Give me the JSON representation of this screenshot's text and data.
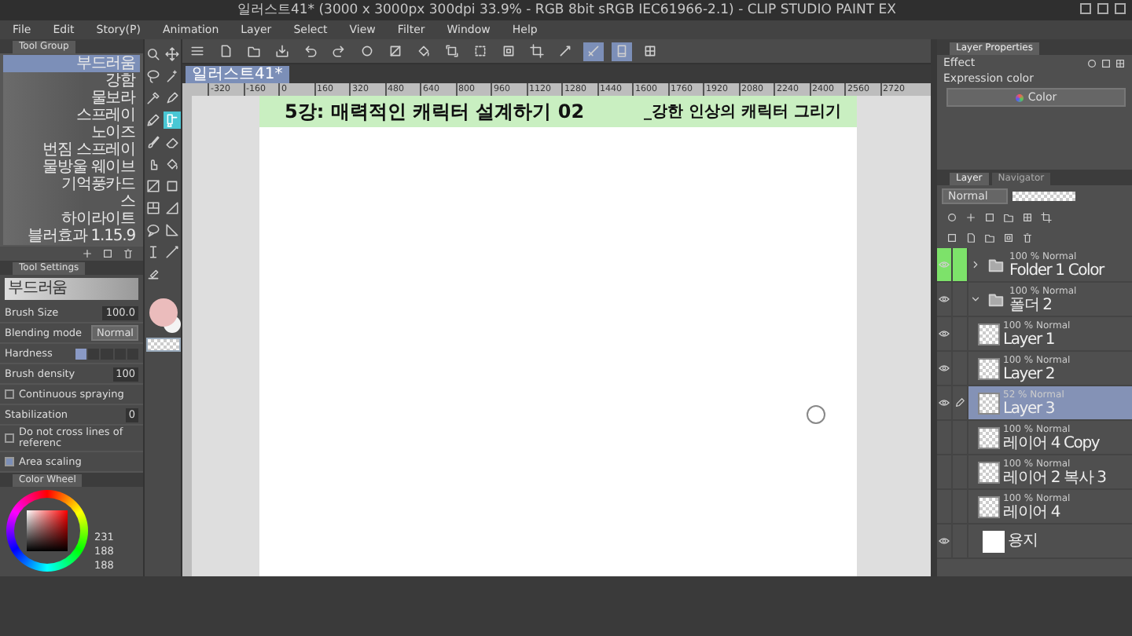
{
  "window": {
    "title": "일러스트41* (3000 x 3000px 300dpi 33.9% - RGB 8bit sRGB IEC61966-2.1) - CLIP STUDIO PAINT EX"
  },
  "menu": [
    "File",
    "Edit",
    "Story(P)",
    "Animation",
    "Layer",
    "Select",
    "View",
    "Filter",
    "Window",
    "Help"
  ],
  "toolbar": [
    {
      "kind": "menu",
      "selected": false
    },
    {
      "kind": "new",
      "selected": false
    },
    {
      "kind": "open",
      "selected": false
    },
    {
      "kind": "save",
      "selected": false
    },
    {
      "kind": "undo",
      "selected": false
    },
    {
      "kind": "redo",
      "selected": false
    },
    {
      "kind": "spinner",
      "selected": false
    },
    {
      "kind": "clear",
      "selected": false
    },
    {
      "kind": "fill",
      "selected": false
    },
    {
      "kind": "transform",
      "selected": false
    },
    {
      "kind": "deselect",
      "selected": false
    },
    {
      "kind": "invert",
      "selected": false
    },
    {
      "kind": "crop",
      "selected": false
    },
    {
      "kind": "snap_ruler",
      "selected": false
    },
    {
      "kind": "snap_special",
      "selected": true
    },
    {
      "kind": "snap_grid",
      "selected": true
    },
    {
      "kind": "grid",
      "selected": false
    }
  ],
  "tool_group": {
    "tab": "Tool Group",
    "items": [
      {
        "label": "부드러움",
        "selected": true
      },
      {
        "label": "강함",
        "selected": false
      },
      {
        "label": "물보라",
        "selected": false
      },
      {
        "label": "스프레이",
        "selected": false
      },
      {
        "label": "노이즈",
        "selected": false
      },
      {
        "label": "번짐 스프레이",
        "selected": false
      },
      {
        "label": "물방울 웨이브",
        "selected": false
      },
      {
        "label": "기억풍카드",
        "selected": false
      },
      {
        "label": "스",
        "selected": false
      },
      {
        "label": "하이라이트",
        "selected": false
      },
      {
        "label": "블러효과 1.15.9",
        "selected": false
      }
    ]
  },
  "tool_settings": {
    "tab": "Tool Settings",
    "preset": "부드러움",
    "brush_size": {
      "label": "Brush Size",
      "value": "100.0"
    },
    "blending_mode": {
      "label": "Blending mode",
      "value": "Normal"
    },
    "hardness": {
      "label": "Hardness",
      "level": 0.2
    },
    "brush_density": {
      "label": "Brush density",
      "value": "100"
    },
    "continuous_spraying": {
      "label": "Continuous spraying",
      "checked": false
    },
    "stabilization": {
      "label": "Stabilization",
      "value": "0"
    },
    "do_not_cross": {
      "label": "Do not cross lines of referenc",
      "checked": false
    },
    "area_scaling": {
      "label": "Area scaling",
      "checked": true
    }
  },
  "color_wheel": {
    "tab": "Color Wheel",
    "r": "231",
    "g": "188",
    "b": "188"
  },
  "tools": [
    {
      "kind": "zoom",
      "selected": false
    },
    {
      "kind": "move",
      "selected": false
    },
    {
      "kind": "lasso",
      "selected": false
    },
    {
      "kind": "wand",
      "selected": false
    },
    {
      "kind": "eyedropper",
      "selected": false
    },
    {
      "kind": "pen",
      "selected": false
    },
    {
      "kind": "pencil",
      "selected": false
    },
    {
      "kind": "airbrush",
      "selected": true
    },
    {
      "kind": "brush",
      "selected": false
    },
    {
      "kind": "eraser",
      "selected": false
    },
    {
      "kind": "blend",
      "selected": false
    },
    {
      "kind": "fill",
      "selected": false
    },
    {
      "kind": "gradient",
      "selected": false
    },
    {
      "kind": "figure",
      "selected": false
    },
    {
      "kind": "frame",
      "selected": false
    },
    {
      "kind": "ruler",
      "selected": false
    },
    {
      "kind": "balloon",
      "selected": false
    },
    {
      "kind": "ruler2",
      "selected": false
    },
    {
      "kind": "text",
      "selected": false
    },
    {
      "kind": "line",
      "selected": false
    },
    {
      "kind": "correct",
      "selected": false
    }
  ],
  "document_tab": "일러스트41*",
  "ruler": [
    "-320",
    "-160",
    "0",
    "160",
    "320",
    "480",
    "640",
    "800",
    "960",
    "1120",
    "1280",
    "1440",
    "1600",
    "1760",
    "1920",
    "2080",
    "2240",
    "2400",
    "2560",
    "2720"
  ],
  "canvas": {
    "title": "5강: 매력적인 캐릭터 설계하기 02",
    "subtitle": "_강한 인상의 캐릭터 그리기"
  },
  "layer_properties": {
    "tab": "Layer Properties",
    "effect_label": "Effect",
    "expression_label": "Expression color",
    "expression_value": "Color"
  },
  "layer_panel": {
    "tabs": [
      {
        "label": "Layer",
        "selected": true
      },
      {
        "label": "Navigator",
        "selected": false
      }
    ],
    "blend_mode": "Normal",
    "opacity": {
      "level": 1
    },
    "layers": [
      {
        "kind": "folder",
        "mode": "100 % Normal",
        "name": "Folder 1 Color",
        "visible": true,
        "highlighted": true,
        "editing": false,
        "selected": false,
        "expanded": false
      },
      {
        "kind": "folder",
        "mode": "100 % Normal",
        "name": "폴더 2",
        "visible": true,
        "highlighted": false,
        "editing": false,
        "selected": false,
        "expanded": true,
        "children": [
          {
            "kind": "layer",
            "mode": "100 % Normal",
            "name": "Layer 1",
            "visible": true,
            "highlighted": false,
            "editing": false,
            "selected": false
          },
          {
            "kind": "layer",
            "mode": "100 % Normal",
            "name": "Layer 2",
            "visible": true,
            "highlighted": false,
            "editing": false,
            "selected": false
          },
          {
            "kind": "layer",
            "mode": "52 % Normal",
            "name": "Layer 3",
            "visible": true,
            "highlighted": false,
            "editing": true,
            "selected": true
          },
          {
            "kind": "layer",
            "mode": "100 % Normal",
            "name": "레이어 4 Copy",
            "visible": false,
            "highlighted": false,
            "editing": false,
            "selected": false
          },
          {
            "kind": "layer",
            "mode": "100 % Normal",
            "name": "레이어 2 복사 3",
            "visible": false,
            "highlighted": false,
            "editing": false,
            "selected": false
          },
          {
            "kind": "layer",
            "mode": "100 % Normal",
            "name": "레이어 4",
            "visible": false,
            "highlighted": false,
            "editing": false,
            "selected": false
          }
        ]
      },
      {
        "kind": "paper",
        "name": "용지",
        "visible": true,
        "highlighted": false,
        "editing": false,
        "selected": false
      }
    ]
  }
}
